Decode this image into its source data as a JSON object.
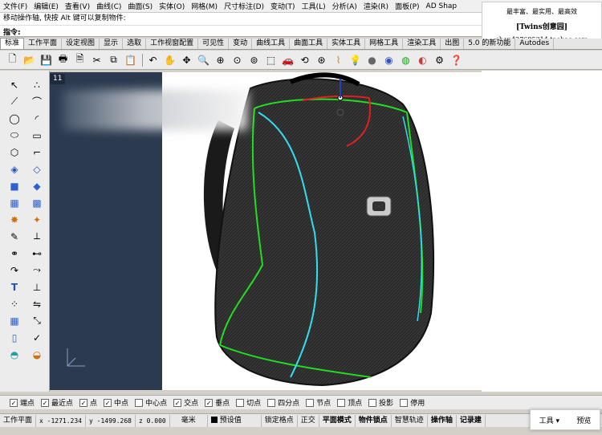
{
  "menu": [
    "文件(F)",
    "编辑(E)",
    "查看(V)",
    "曲线(C)",
    "曲面(S)",
    "实体(O)",
    "网格(M)",
    "尺寸标注(D)",
    "变动(T)",
    "工具(L)",
    "分析(A)",
    "渲染(R)",
    "面板(P)",
    "AD Shap"
  ],
  "command": {
    "history": "移动操作轴, 快按 Alt 键可以复制物件:",
    "prompt": "指令:"
  },
  "shop": {
    "line1": "最丰富、最实用、最高效",
    "line2": "[Twins创意园]",
    "line3": "shop427695314.taobao.com"
  },
  "tabs": [
    "标准",
    "工作平面",
    "设定视图",
    "显示",
    "选取",
    "工作视窗配置",
    "可见性",
    "变动",
    "曲线工具",
    "曲面工具",
    "实体工具",
    "网格工具",
    "渲染工具",
    "出图",
    "5.0 的新功能",
    "Autodes"
  ],
  "active_tab": "标准",
  "toolbar_icons": [
    "new-file-icon",
    "open-folder-icon",
    "save-icon",
    "print-icon",
    "import-icon",
    "cut-icon",
    "copy-icon",
    "paste-icon",
    "undo-icon",
    "pan-hand-icon",
    "rotate-view-icon",
    "zoom-icon",
    "zoom-window-icon",
    "zoom-extents-icon",
    "zoom-selected-icon",
    "select-all-icon",
    "car-icon",
    "transform-icon",
    "point-icon",
    "curve-icon",
    "light-bulb-icon",
    "sphere-icon",
    "render-icon",
    "material-icon",
    "hatch-icon",
    "options-icon",
    "help-icon"
  ],
  "viewport": {
    "title": "11"
  },
  "osnaps": [
    {
      "label": "端点",
      "checked": true
    },
    {
      "label": "最近点",
      "checked": true
    },
    {
      "label": "点",
      "checked": true
    },
    {
      "label": "中点",
      "checked": true
    },
    {
      "label": "中心点",
      "checked": false
    },
    {
      "label": "交点",
      "checked": true
    },
    {
      "label": "垂点",
      "checked": true
    },
    {
      "label": "切点",
      "checked": false
    },
    {
      "label": "四分点",
      "checked": false
    },
    {
      "label": "节点",
      "checked": false
    },
    {
      "label": "顶点",
      "checked": false
    },
    {
      "label": "投影",
      "checked": false
    },
    {
      "label": "停用",
      "checked": false
    }
  ],
  "status": {
    "cplane": "工作平面",
    "x": "x -1271.234",
    "y": "y -1499.268",
    "z": "z 0.000",
    "units": "毫米",
    "layer": "预设值",
    "lock_grid": "锁定格点",
    "ortho": "正交",
    "planar": "平面模式",
    "osnap": "物件锁点",
    "smart_track": "智慧轨迹",
    "gumball": "操作轴",
    "record_history": "记录建"
  },
  "popup": {
    "tools": "工具",
    "preview": "预览"
  },
  "colors": {
    "viewport_bg": "#2b3a4f",
    "curve_green": "#22dd22",
    "curve_cyan": "#33ddee",
    "gumball_red": "#e02020"
  }
}
